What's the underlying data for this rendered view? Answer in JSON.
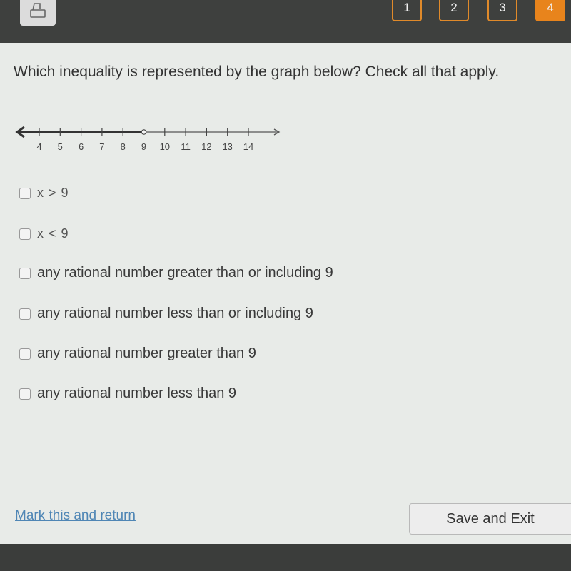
{
  "header": {
    "print_icon": "printer-icon",
    "question_nav": [
      {
        "label": "1",
        "active": false
      },
      {
        "label": "2",
        "active": false
      },
      {
        "label": "3",
        "active": false
      },
      {
        "label": "4",
        "active": true
      }
    ]
  },
  "question": {
    "text": "Which inequality is represented by the graph below? Check all that apply."
  },
  "number_line": {
    "ticks": [
      "4",
      "5",
      "6",
      "7",
      "8",
      "9",
      "10",
      "11",
      "12",
      "13",
      "14"
    ],
    "boundary": 9,
    "boundary_type": "open",
    "shaded_direction": "left"
  },
  "options": [
    {
      "label": "x > 9",
      "checked": false
    },
    {
      "label": "x < 9",
      "checked": false
    },
    {
      "label": "any rational number greater than or including 9",
      "checked": false
    },
    {
      "label": "any rational number less than or including 9",
      "checked": false
    },
    {
      "label": "any rational number greater than 9",
      "checked": false
    },
    {
      "label": "any rational number less than 9",
      "checked": false
    }
  ],
  "footer": {
    "mark_link": "Mark this and return",
    "save_button": "Save and Exit"
  },
  "colors": {
    "accent": "#e8841c",
    "link": "#4f86b5"
  }
}
